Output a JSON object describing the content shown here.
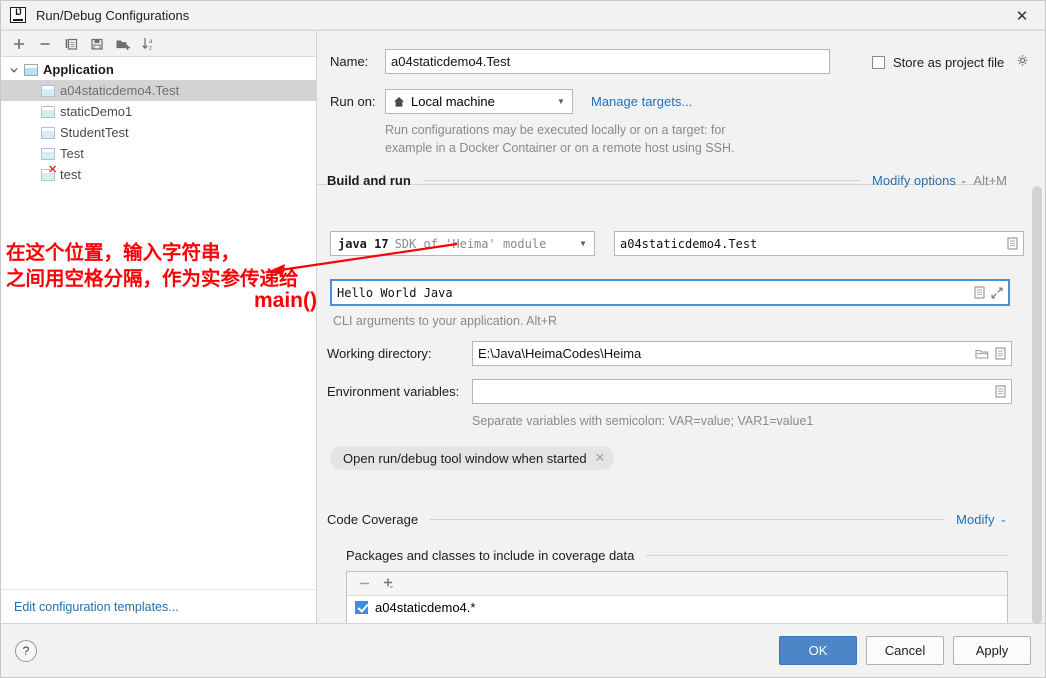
{
  "window": {
    "title": "Run/Debug Configurations",
    "logo_text": "IJ",
    "close_label": "✕"
  },
  "left_pane": {
    "toolbar": [
      {
        "name": "add-configuration",
        "icon": "plus-icon"
      },
      {
        "name": "remove-configuration",
        "icon": "minus-icon"
      },
      {
        "name": "copy-configuration",
        "icon": "copy-icon"
      },
      {
        "name": "save-configuration",
        "icon": "save-icon"
      },
      {
        "name": "move-into-folder",
        "icon": "folder-add-icon"
      },
      {
        "name": "sort-configurations",
        "icon": "sort-alpha-icon"
      }
    ],
    "tree": {
      "group_label": "Application",
      "items": [
        {
          "label": "a04staticdemo4.Test",
          "selected": true,
          "error": false
        },
        {
          "label": "staticDemo1",
          "selected": false,
          "error": false
        },
        {
          "label": "StudentTest",
          "selected": false,
          "error": false
        },
        {
          "label": "Test",
          "selected": false,
          "error": false
        },
        {
          "label": "test",
          "selected": false,
          "error": true
        }
      ]
    },
    "edit_templates_link": "Edit configuration templates..."
  },
  "form": {
    "name_label": "Name:",
    "name_value": "a04staticdemo4.Test",
    "store_as_project_file_label": "Store as project file",
    "store_as_project_file_checked": false,
    "run_on_label": "Run on:",
    "run_on_value": "Local machine",
    "manage_targets_link": "Manage targets...",
    "run_on_hint_line1": "Run configurations may be executed locally or on a target: for",
    "run_on_hint_line2": "example in a Docker Container or on a remote host using SSH.",
    "build_and_run": {
      "section_title": "Build and run",
      "modify_options_link": "Modify options",
      "modify_options_shortcut": "Alt+M",
      "jdk_value_bold": "java 17",
      "jdk_value_rest": "SDK of 'Heima' module",
      "main_class_value": "a04staticdemo4.Test",
      "cli_args_value": "Hello World Java",
      "cli_args_hint": "CLI arguments to your application. Alt+R"
    },
    "working_directory_label": "Working directory:",
    "working_directory_value": "E:\\Java\\HeimaCodes\\Heima",
    "environment_variables_label": "Environment variables:",
    "environment_variables_value": "",
    "environment_hint": "Separate variables with semicolon: VAR=value; VAR1=value1",
    "open_tool_window_chip": "Open run/debug tool window when started",
    "code_coverage": {
      "section_title": "Code Coverage",
      "modify_link": "Modify",
      "subsection_title": "Packages and classes to include in coverage data",
      "entries": [
        {
          "label": "a04staticdemo4.*",
          "checked": true
        }
      ]
    }
  },
  "buttons": {
    "help": "?",
    "ok": "OK",
    "cancel": "Cancel",
    "apply": "Apply"
  },
  "annotation": {
    "line1": "在这个位置，输入字符串，",
    "line2": "之间用空格分隔，作为实参传递给",
    "line3": "main()",
    "color": "#fb0007"
  }
}
